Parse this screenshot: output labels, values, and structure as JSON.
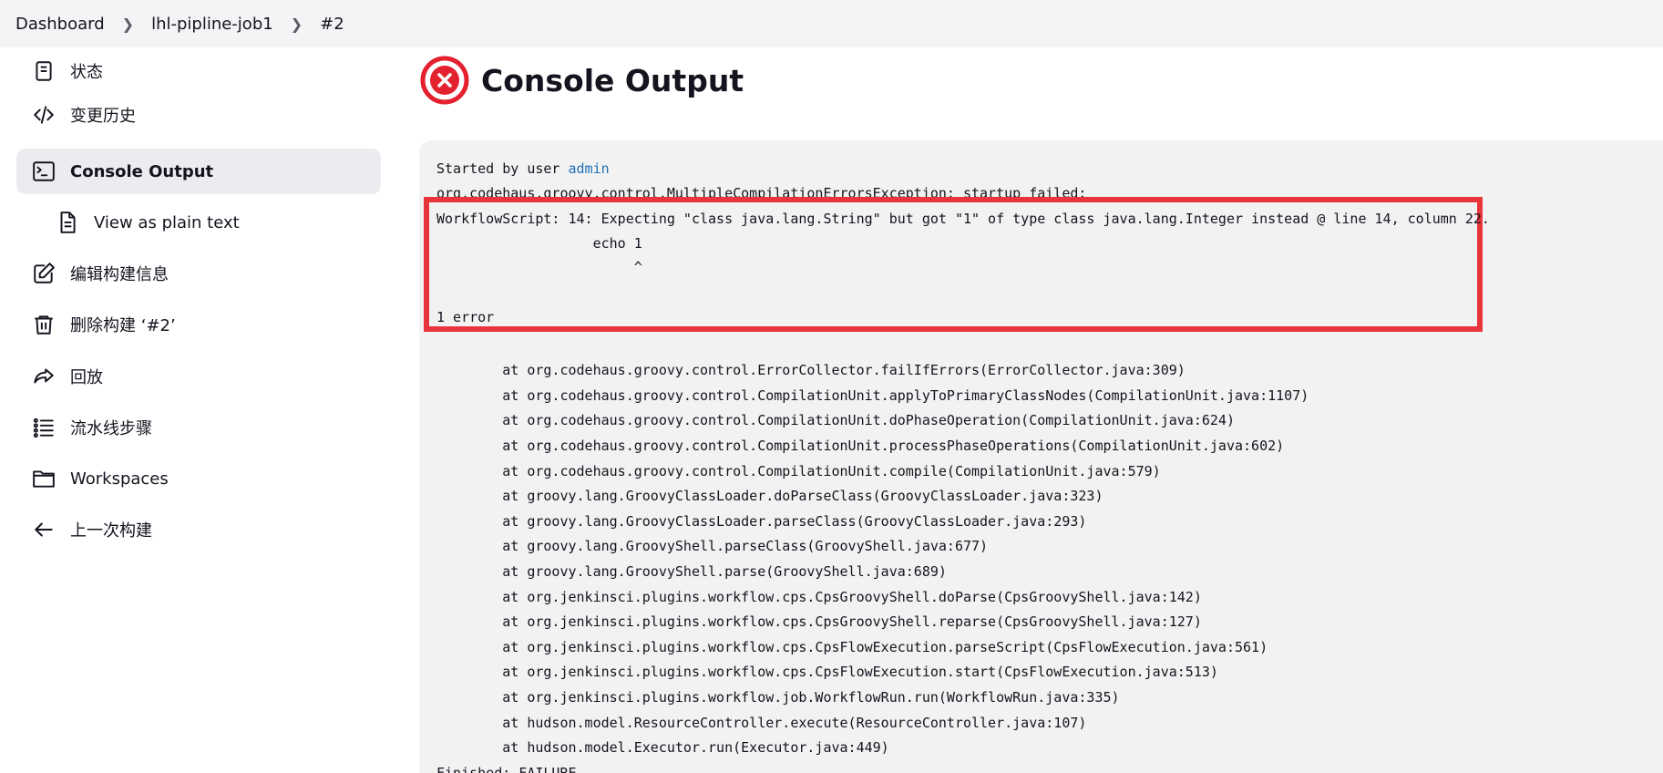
{
  "breadcrumb": {
    "items": [
      "Dashboard",
      "lhl-pipline-job1",
      "#2"
    ],
    "separator": ">"
  },
  "sidebar": {
    "items": [
      {
        "label": "状态",
        "icon": "document-icon"
      },
      {
        "label": "变更历史",
        "icon": "code-icon"
      },
      {
        "label": "Console Output",
        "icon": "terminal-icon",
        "active": true
      },
      {
        "label": "View as plain text",
        "icon": "file-text-icon"
      },
      {
        "label": "编辑构建信息",
        "icon": "edit-icon"
      },
      {
        "label": "删除构建 ‘#2’",
        "icon": "trash-icon"
      },
      {
        "label": "回放",
        "icon": "replay-icon"
      },
      {
        "label": "流水线步骤",
        "icon": "list-icon"
      },
      {
        "label": "Workspaces",
        "icon": "folder-icon"
      },
      {
        "label": "上一次构建",
        "icon": "arrow-left-icon"
      }
    ]
  },
  "main": {
    "title": "Console Output",
    "status_icon": "failure-icon",
    "status_color": "#e3212f"
  },
  "console": {
    "started_prefix": "Started by user ",
    "started_user": "admin",
    "exception_line": "org.codehaus.groovy.control.MultipleCompilationErrorsException: startup failed:",
    "error_lines": [
      "WorkflowScript: 14: Expecting \"class java.lang.String\" but got \"1\" of type class java.lang.Integer instead @ line 14, column 22.",
      "                   echo 1",
      "                        ^",
      "",
      "1 error"
    ],
    "stack": [
      "        at org.codehaus.groovy.control.ErrorCollector.failIfErrors(ErrorCollector.java:309)",
      "        at org.codehaus.groovy.control.CompilationUnit.applyToPrimaryClassNodes(CompilationUnit.java:1107)",
      "        at org.codehaus.groovy.control.CompilationUnit.doPhaseOperation(CompilationUnit.java:624)",
      "        at org.codehaus.groovy.control.CompilationUnit.processPhaseOperations(CompilationUnit.java:602)",
      "        at org.codehaus.groovy.control.CompilationUnit.compile(CompilationUnit.java:579)",
      "        at groovy.lang.GroovyClassLoader.doParseClass(GroovyClassLoader.java:323)",
      "        at groovy.lang.GroovyClassLoader.parseClass(GroovyClassLoader.java:293)",
      "        at groovy.lang.GroovyShell.parseClass(GroovyShell.java:677)",
      "        at groovy.lang.GroovyShell.parse(GroovyShell.java:689)",
      "        at org.jenkinsci.plugins.workflow.cps.CpsGroovyShell.doParse(CpsGroovyShell.java:142)",
      "        at org.jenkinsci.plugins.workflow.cps.CpsGroovyShell.reparse(CpsGroovyShell.java:127)",
      "        at org.jenkinsci.plugins.workflow.cps.CpsFlowExecution.parseScript(CpsFlowExecution.java:561)",
      "        at org.jenkinsci.plugins.workflow.cps.CpsFlowExecution.start(CpsFlowExecution.java:513)",
      "        at org.jenkinsci.plugins.workflow.job.WorkflowRun.run(WorkflowRun.java:335)",
      "        at hudson.model.ResourceController.execute(ResourceController.java:107)",
      "        at hudson.model.Executor.run(Executor.java:449)"
    ],
    "finished": "Finished: FAILURE"
  },
  "highlight_color": "#e8353c"
}
